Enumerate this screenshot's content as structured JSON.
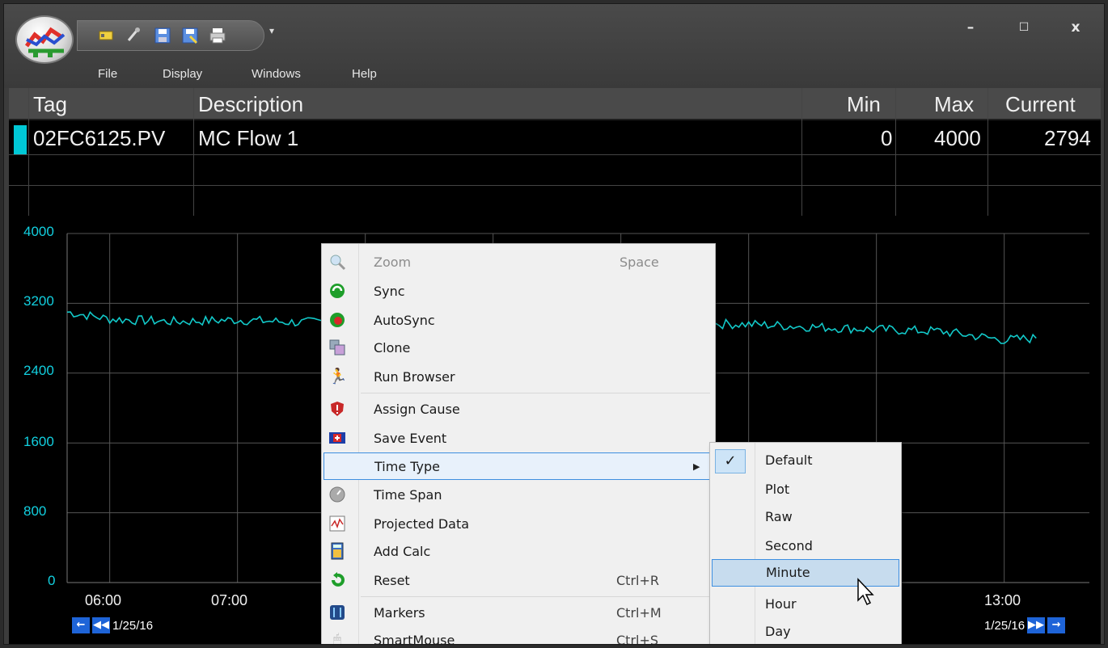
{
  "toolbar": {
    "quick_access": [
      "tag-icon",
      "brush-icon",
      "save-icon",
      "save-as-icon",
      "print-icon"
    ],
    "dropdown": "chevron-down-icon"
  },
  "menu": {
    "items": [
      "File",
      "Display",
      "Windows",
      "Help"
    ]
  },
  "window_controls": {
    "minimize": "–",
    "maximize": "☐",
    "close": "x"
  },
  "table": {
    "headers": {
      "tag": "Tag",
      "description": "Description",
      "min": "Min",
      "max": "Max",
      "current": "Current"
    },
    "rows": [
      {
        "tag": "02FC6125.PV",
        "description": "MC Flow 1",
        "min": "0",
        "max": "4000",
        "current": "2794",
        "color": "#00c8d6"
      }
    ]
  },
  "chart_data": {
    "type": "line",
    "ylim": [
      0,
      4000
    ],
    "y_ticks": [
      "4000",
      "3200",
      "2400",
      "1600",
      "800",
      "0"
    ],
    "x_ticks": [
      "06:00",
      "07:00",
      "13:00"
    ],
    "start_date": "1/25/16",
    "end_date": "1/25/16",
    "grid": true,
    "series": [
      {
        "color": "#12c9c9",
        "x": [
          "05:40",
          "06:00",
          "06:30",
          "07:00",
          "07:30",
          "08:00",
          "11:00",
          "11:30",
          "12:00",
          "12:30",
          "13:00",
          "13:15"
        ],
        "values": [
          3100,
          3020,
          2990,
          3010,
          2980,
          3010,
          2960,
          2930,
          2900,
          2880,
          2780,
          2800
        ]
      }
    ]
  },
  "context_menu": {
    "items": [
      {
        "label": "Zoom",
        "shortcut": "Space",
        "icon": "magnifier-icon",
        "disabled": true
      },
      {
        "label": "Sync",
        "shortcut": "",
        "icon": "sync-icon"
      },
      {
        "label": "AutoSync",
        "shortcut": "",
        "icon": "autosync-icon"
      },
      {
        "label": "Clone",
        "shortcut": "",
        "icon": "clone-icon"
      },
      {
        "label": "Run Browser",
        "shortcut": "",
        "icon": "runner-icon"
      },
      {
        "label": "Assign Cause",
        "shortcut": "",
        "icon": "shield-alert-icon"
      },
      {
        "label": "Save Event",
        "shortcut": "",
        "icon": "event-flag-icon"
      },
      {
        "label": "Time Type",
        "shortcut": "",
        "icon": "",
        "submenu": true
      },
      {
        "label": "Time Span",
        "shortcut": "",
        "icon": "clock-icon"
      },
      {
        "label": "Projected Data",
        "shortcut": "",
        "icon": "trend-icon"
      },
      {
        "label": "Add Calc",
        "shortcut": "",
        "icon": "calculator-icon"
      },
      {
        "label": "Reset",
        "shortcut": "Ctrl+R",
        "icon": "reset-icon"
      },
      {
        "label": "Markers",
        "shortcut": "Ctrl+M",
        "icon": "markers-icon"
      },
      {
        "label": "SmartMouse",
        "shortcut": "Ctrl+S",
        "icon": "mouse-icon"
      }
    ]
  },
  "submenu": {
    "items": [
      "Default",
      "Plot",
      "Raw",
      "Second",
      "Minute",
      "Hour",
      "Day"
    ],
    "checked": "Default",
    "highlighted": "Minute"
  }
}
